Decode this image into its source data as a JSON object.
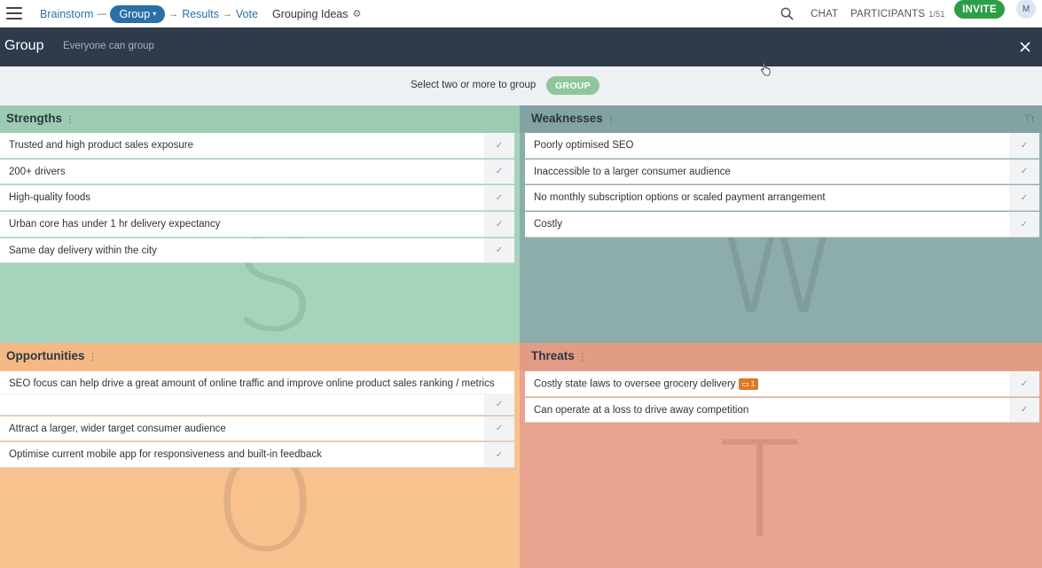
{
  "nav": {
    "breadcrumbs": [
      "Brainstorm",
      "Group",
      "Results",
      "Vote"
    ],
    "active": "Group",
    "board_title": "Grouping Ideas",
    "chat_label": "CHAT",
    "participants_label": "PARTICIPANTS",
    "participants_count": "1/51",
    "invite_label": "INVITE",
    "avatar_initial": "M"
  },
  "header": {
    "title": "Group",
    "subtitle": "Everyone can group"
  },
  "instruction": {
    "text": "Select two or more to group",
    "button_label": "GROUP"
  },
  "quadrants": {
    "strengths": {
      "title": "Strengths",
      "watermark": "S",
      "cards": [
        "Trusted and high product sales exposure",
        "200+ drivers",
        "High-quality foods",
        "Urban core has under 1 hr delivery expectancy",
        "Same day delivery within the city"
      ]
    },
    "weaknesses": {
      "title": "Weaknesses",
      "watermark": "W",
      "cards": [
        "Poorly optimised SEO",
        "Inaccessible to a larger consumer audience",
        "No monthly subscription options or scaled payment arrangement",
        "Costly"
      ]
    },
    "opportunities": {
      "title": "Opportunities",
      "watermark": "O",
      "cards": [
        "SEO focus can help drive a great amount of online traffic and improve online product sales ranking / metrics",
        "Attract a larger, wider target consumer audience",
        "Optimise current mobile app for responsiveness and built-in feedback"
      ]
    },
    "threats": {
      "title": "Threats",
      "watermark": "T",
      "cards": [
        "Costly state laws to oversee grocery delivery",
        "Can operate at a loss to drive away competition"
      ],
      "comment_badge": "1"
    }
  },
  "icons": {
    "check": "✓",
    "dots": "⋮",
    "text_size": "Tт",
    "crumb_arrow": "→",
    "chevron": "⌄",
    "gear": "⚙"
  }
}
